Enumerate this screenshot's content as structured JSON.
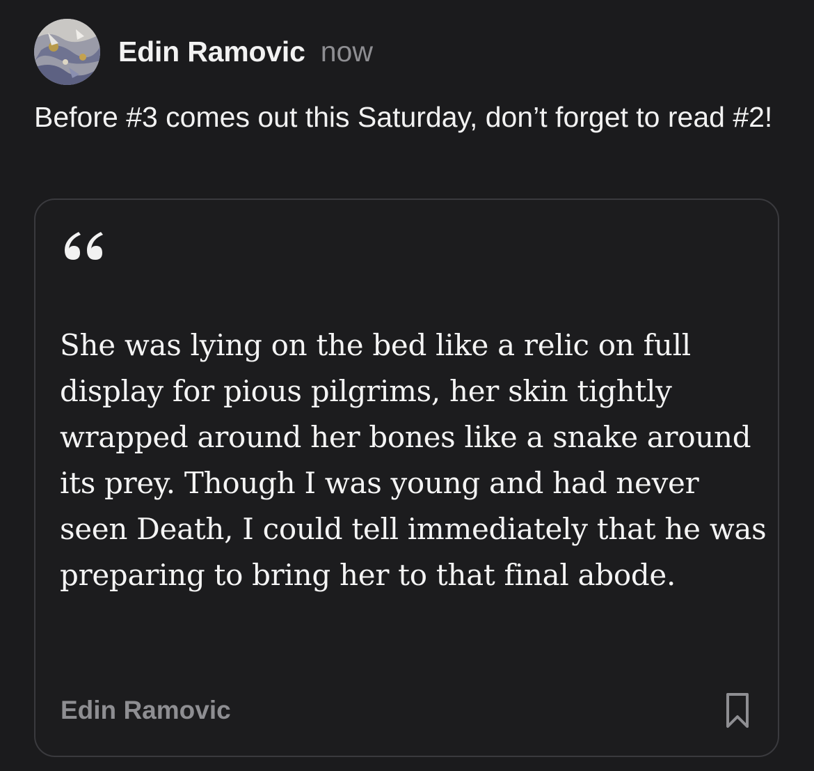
{
  "post": {
    "author": "Edin Ramovic",
    "timestamp": "now",
    "text": "Before #3 comes out this Saturday, don’t forget to read #2!",
    "avatar_icon": "avatar-image"
  },
  "quote": {
    "icon": "quote-mark-icon",
    "text": "She was lying on the bed like a relic on full display for pious pilgrims, her skin tightly wrapped around her bones like a snake around its prey. Though I was young and had never seen Death, I could tell immediately that he was preparing to bring her to that final abode.",
    "author": "Edin Ramovic",
    "bookmark_icon": "bookmark-icon"
  },
  "colors": {
    "background": "#1b1b1d",
    "text": "#f2f2f2",
    "muted": "#8e8e92",
    "card_border": "#3a3a3e"
  }
}
